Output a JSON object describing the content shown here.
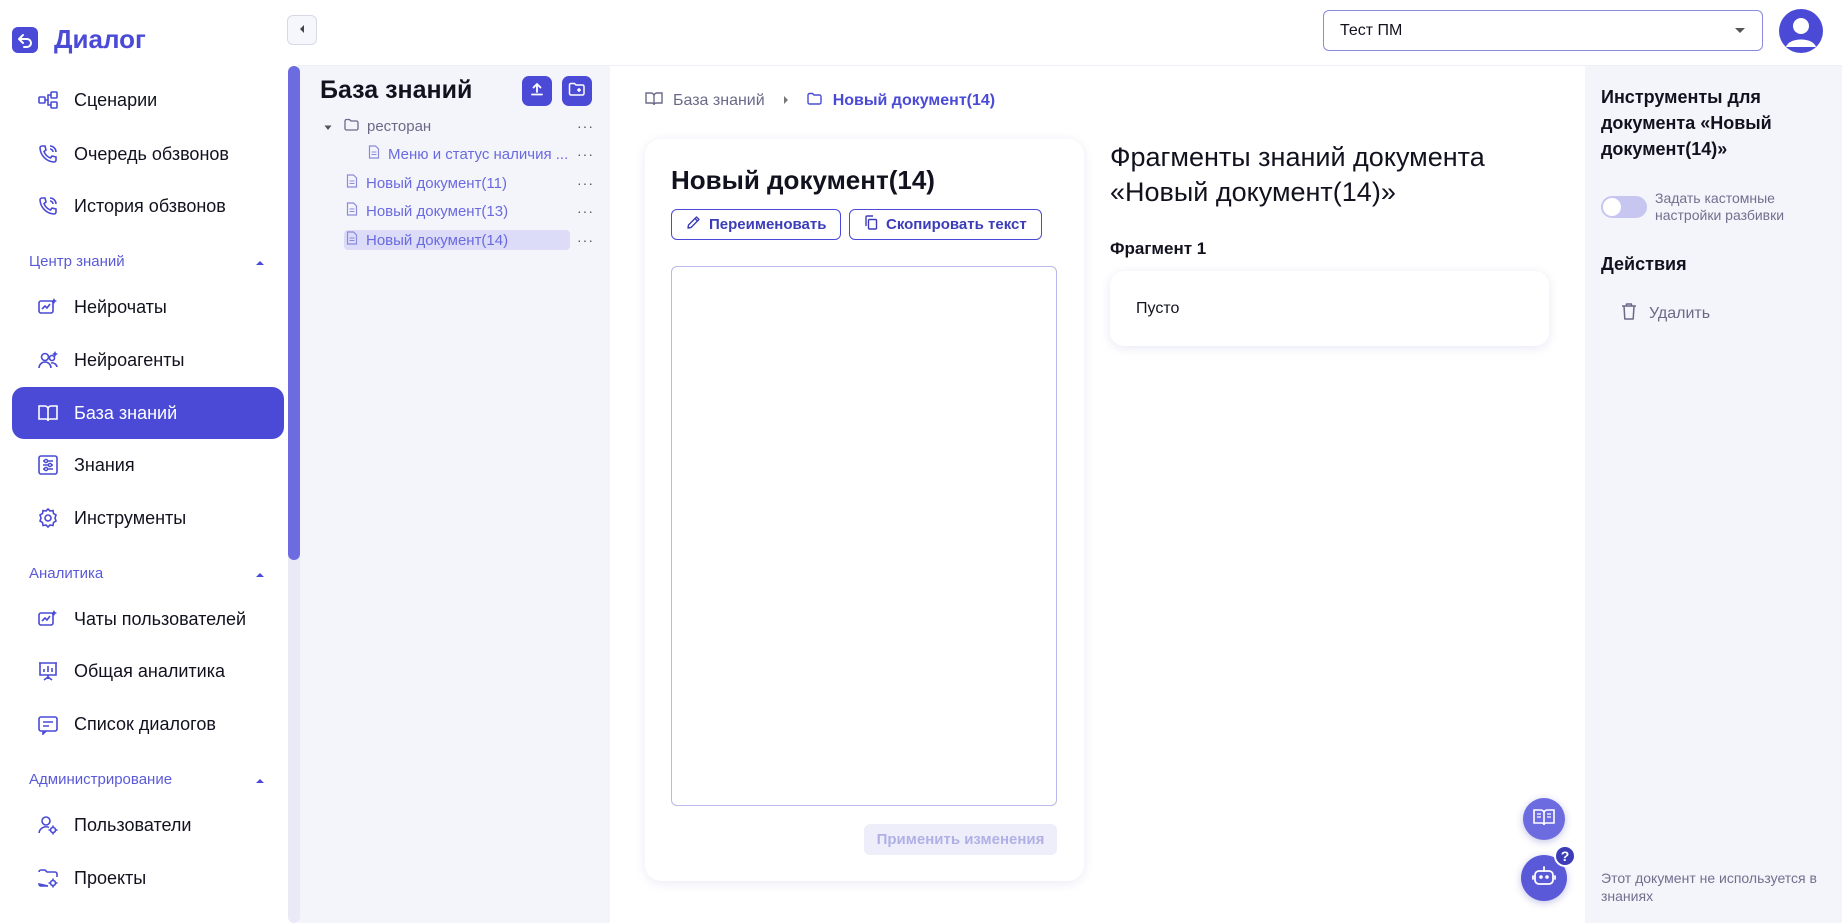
{
  "app": {
    "name": "Диалог"
  },
  "sidebar": {
    "items_top": [
      {
        "label": "Сценарии",
        "icon": "scenarios-icon"
      },
      {
        "label": "Очередь обзвонов",
        "icon": "phone-queue-icon"
      },
      {
        "label": "История обзвонов",
        "icon": "phone-history-icon"
      }
    ],
    "sections": [
      {
        "title": "Центр знаний",
        "items": [
          "Нейрочаты",
          "Нейроагенты",
          "База знаний",
          "Знания",
          "Инструменты"
        ]
      },
      {
        "title": "Аналитика",
        "items": [
          "Чаты пользователей",
          "Общая аналитика",
          "Список диалогов"
        ]
      },
      {
        "title": "Администрирование",
        "items": [
          "Пользователи",
          "Проекты"
        ]
      }
    ],
    "active_item": "База знаний",
    "accent": "#4a4ad6"
  },
  "header": {
    "project": "Тест ПМ"
  },
  "tree": {
    "title": "База знаний",
    "nodes": [
      {
        "label": "ресторан",
        "type": "folder"
      },
      {
        "label": "Меню и статус наличия ...",
        "type": "document"
      },
      {
        "label": "Новый документ(11)",
        "type": "document"
      },
      {
        "label": "Новый документ(13)",
        "type": "document"
      },
      {
        "label": "Новый документ(14)",
        "type": "document",
        "selected": true
      }
    ],
    "more": "···"
  },
  "breadcrumb": {
    "root": "База знаний",
    "current": "Новый документ(14)"
  },
  "document": {
    "title": "Новый документ(14)",
    "rename_label": "Переименовать",
    "copy_label": "Скопировать текст",
    "text": "",
    "apply_label": "Применить изменения"
  },
  "fragments": {
    "title": "Фрагменты знаний документа «Новый документ(14)»",
    "items": [
      {
        "label": "Фрагмент 1",
        "text": "Пусто"
      }
    ]
  },
  "tools": {
    "title": "Инструменты для документа «Новый документ(14)»",
    "toggle_label": "Задать кастомные настройки разбивки",
    "toggle_on": false,
    "actions_title": "Действия",
    "delete_label": "Удалить",
    "footer_note": "Этот документ не используется в знаниях"
  },
  "help": {
    "badge": "?"
  }
}
